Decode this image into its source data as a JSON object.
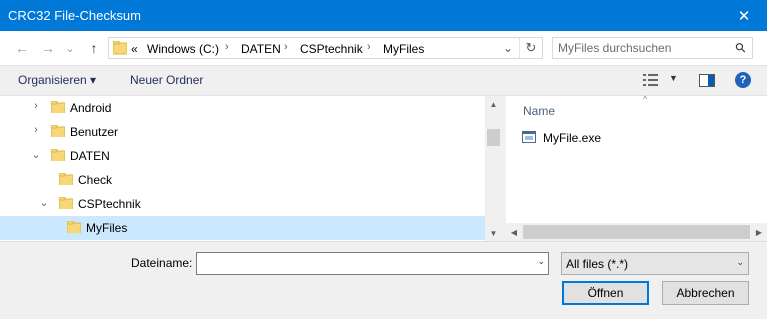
{
  "window": {
    "title": "CRC32 File-Checksum",
    "close_glyph": "✕"
  },
  "nav": {
    "back_glyph": "←",
    "forward_glyph": "→",
    "recent_glyph": "⌄",
    "up_glyph": "↑"
  },
  "address": {
    "overflow": "«",
    "crumbs": [
      "Windows (C:)",
      "DATEN",
      "CSPtechnik",
      "MyFiles"
    ],
    "separator": "›",
    "dropdown_glyph": "⌄",
    "refresh_glyph": "↻"
  },
  "search": {
    "placeholder": "MyFiles durchsuchen",
    "icon_glyph": "⚲"
  },
  "toolbar": {
    "organize_label": "Organisieren ▾",
    "new_folder_label": "Neuer Ordner",
    "help_glyph": "?"
  },
  "tree": {
    "items": [
      {
        "label": "Android",
        "chevron": "›",
        "level": 1
      },
      {
        "label": "Benutzer",
        "chevron": "›",
        "level": 1
      },
      {
        "label": "DATEN",
        "chevron": "⌄",
        "level": 1
      },
      {
        "label": "Check",
        "chevron": "",
        "level": 2
      },
      {
        "label": "CSPtechnik",
        "chevron": "⌄",
        "level": 2
      },
      {
        "label": "MyFiles",
        "chevron": "",
        "level": 3,
        "selected": true
      }
    ]
  },
  "files": {
    "column_name": "Name",
    "sort_glyph": "^",
    "items": [
      {
        "label": "MyFile.exe"
      }
    ]
  },
  "bottom": {
    "filename_label": "Dateiname:",
    "filename_value": "",
    "filter_value": "All files (*.*)",
    "open_label": "Öffnen",
    "cancel_label": "Abbrechen"
  },
  "colors": {
    "titlebar": "#0078d7",
    "selection": "#cce8ff",
    "folder": "#f8d775"
  }
}
